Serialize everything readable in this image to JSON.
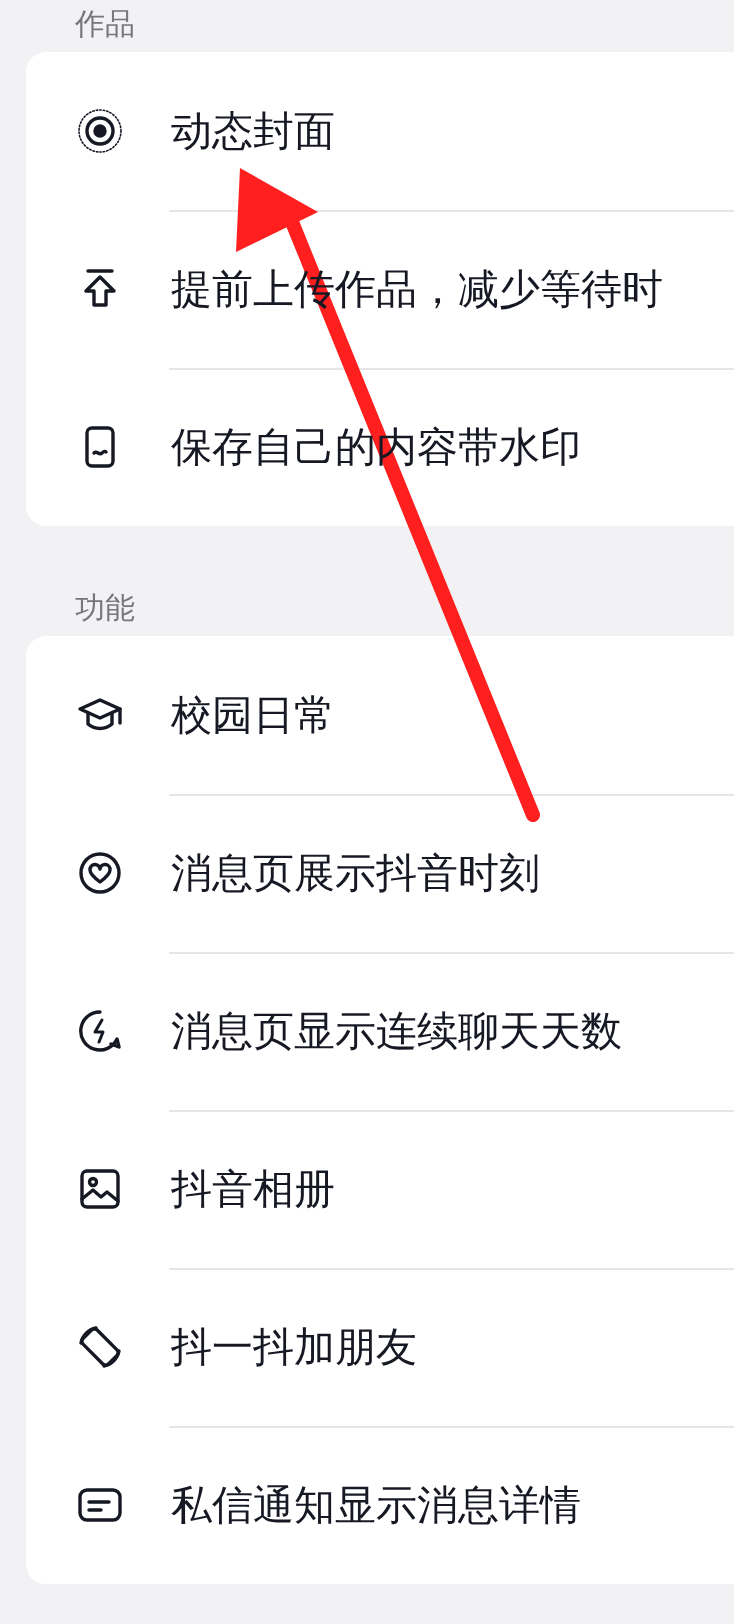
{
  "sections": [
    {
      "title": "作品",
      "items": [
        {
          "label": "动态封面"
        },
        {
          "label": "提前上传作品，减少等待时"
        },
        {
          "label": "保存自己的内容带水印"
        }
      ]
    },
    {
      "title": "功能",
      "items": [
        {
          "label": "校园日常"
        },
        {
          "label": "消息页展示抖音时刻"
        },
        {
          "label": "消息页显示连续聊天天数"
        },
        {
          "label": "抖音相册"
        },
        {
          "label": "抖一抖加朋友"
        },
        {
          "label": "私信通知显示消息详情"
        }
      ]
    }
  ]
}
